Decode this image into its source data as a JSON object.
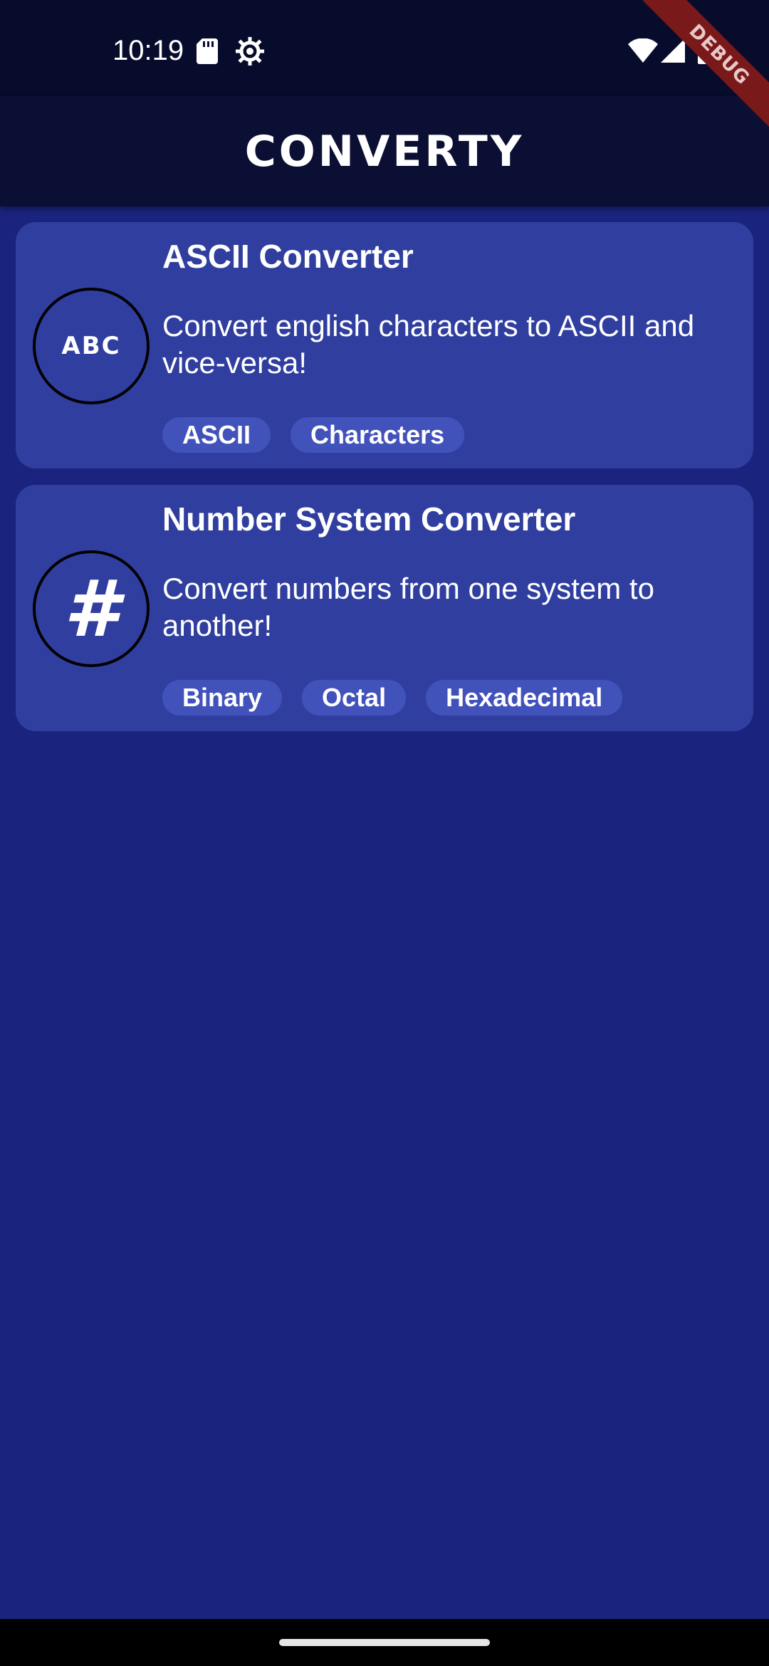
{
  "status_bar": {
    "time": "10:19",
    "icons": [
      "sd-card-icon",
      "gear-icon",
      "wifi-icon",
      "signal-icon",
      "battery-icon"
    ]
  },
  "debug_banner": {
    "label": "DEBUG",
    "color": "#7a1919"
  },
  "app_bar": {
    "title": "CONVERTY",
    "background": "#0a0f33"
  },
  "converters": [
    {
      "icon": "abc-icon",
      "icon_text": "ABC",
      "title": "ASCII Converter",
      "description": "Convert english characters to ASCII and vice-versa!",
      "tags": [
        "ASCII",
        "Characters"
      ]
    },
    {
      "icon": "hash-icon",
      "icon_text": "#",
      "title": "Number System Converter",
      "description": "Convert numbers from one system to another!",
      "tags": [
        "Binary",
        "Octal",
        "Hexadecimal"
      ]
    }
  ],
  "colors": {
    "page_background": "#1a237e",
    "card_background": "#303f9f",
    "chip_background": "#4252bb"
  }
}
